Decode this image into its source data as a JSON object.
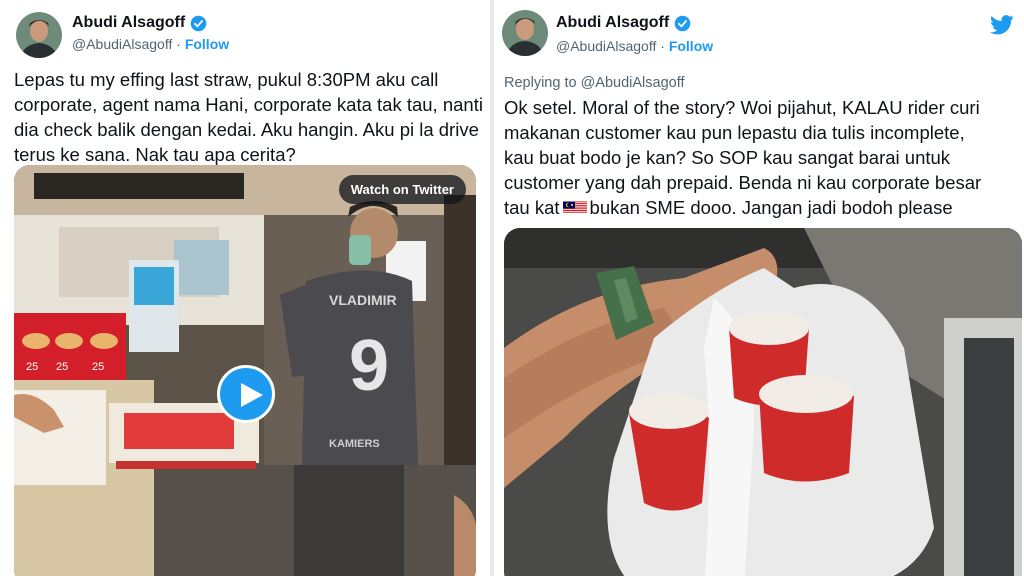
{
  "left_tweet": {
    "author_name": "Abudi Alsagoff",
    "handle": "@AbudiAlsagoff",
    "separator": "·",
    "follow_label": "Follow",
    "lines": [
      "Lepas tu my effing last straw, pukul 8:30PM aku call",
      "corporate, agent nama Hani, corporate kata tak tau, nanti",
      "dia check balik dengan kedai.  Aku hangin. Aku pi la drive",
      "terus ke sana. Nak tau apa cerita?"
    ],
    "video": {
      "watch_label": "Watch on Twitter",
      "shirt_name": "VLADIMIR",
      "shirt_number": "9",
      "shirt_back_text": "KAMIERS",
      "promo_prices": [
        "25",
        "25",
        "25"
      ],
      "icon": "play-icon"
    }
  },
  "right_tweet": {
    "author_name": "Abudi Alsagoff",
    "handle": "@AbudiAlsagoff",
    "separator": "·",
    "follow_label": "Follow",
    "replying_to": "Replying to @AbudiAlsagoff",
    "lines": [
      "Ok setel.  Moral of the story? Woi pijahut, KALAU rider curi",
      "makanan customer kau pun lepastu dia tulis incomplete,",
      "kau buat bodo je kan? So SOP kau sangat barai untuk",
      "customer yang dah prepaid. Benda ni kau corporate besar"
    ],
    "last_line_before_flag": "tau kat",
    "last_line_after_flag": "bukan SME dooo. Jangan jadi bodoh please",
    "flag_icon": "malaysia-flag-icon",
    "brand_icon": "twitter-bird-icon"
  },
  "colors": {
    "accent": "#1d9bf0",
    "secondary_text": "#536471",
    "primary_text": "#0f1419"
  }
}
